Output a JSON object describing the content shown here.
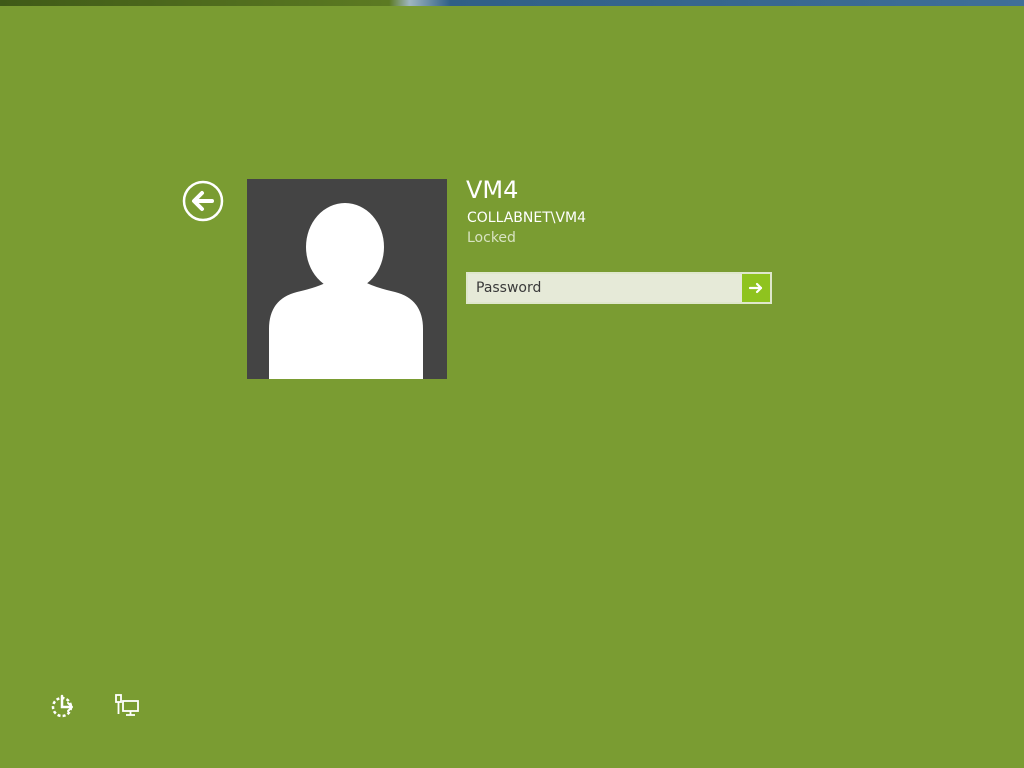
{
  "theme": {
    "background": "#7a9c32",
    "avatar_background": "#444444",
    "submit_accent": "#8fc31f"
  },
  "user": {
    "name": "VM4",
    "domain_account": "COLLABNET\\VM4",
    "status": "Locked"
  },
  "password": {
    "value": "",
    "placeholder": "Password"
  },
  "icons": {
    "back": "arrow-left-circle",
    "submit": "arrow-right",
    "ease_of_access": "ease-of-access",
    "network": "network-computer"
  }
}
